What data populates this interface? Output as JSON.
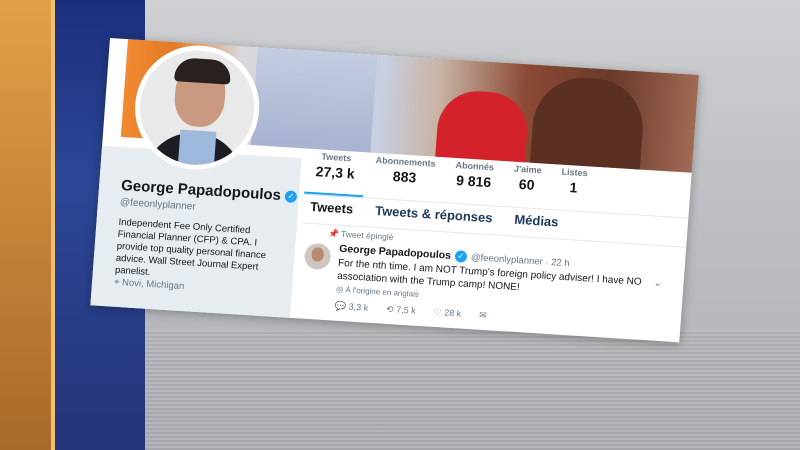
{
  "profile": {
    "name": "George Papadopoulos",
    "handle": "@feeonlyplanner",
    "bio": "Independent Fee Only Certified Financial Planner (CFP) & CPA. I provide top quality personal finance advice. Wall Street Journal Expert panelist.",
    "location": "Novi, Michigan"
  },
  "stats": [
    {
      "label": "Tweets",
      "value": "27,3 k"
    },
    {
      "label": "Abonnements",
      "value": "883"
    },
    {
      "label": "Abonnés",
      "value": "9 816"
    },
    {
      "label": "J'aime",
      "value": "60"
    },
    {
      "label": "Listes",
      "value": "1"
    }
  ],
  "tabs": [
    "Tweets",
    "Tweets & réponses",
    "Médias"
  ],
  "tweet": {
    "pinned_label": "Tweet épinglé",
    "author": "George Papadopoulos",
    "handle_time": "@feeonlyplanner · 22 h",
    "text": "For the nth time. I am NOT Trump's foreign policy adviser! I have NO association with the Trump camp! NONE!",
    "origin": "À l'origine en anglais",
    "replies": "3,3 k",
    "retweets": "7,5 k",
    "likes": "28 k"
  },
  "icons": {
    "verified": "verified-badge-icon",
    "location": "location-pin-icon",
    "pin": "pin-icon",
    "reply": "reply-icon",
    "retweet": "retweet-icon",
    "like": "heart-icon",
    "message": "envelope-icon",
    "chevron": "chevron-down-icon"
  },
  "colors": {
    "accent": "#1da1f2",
    "text": "#14171a",
    "muted": "#657786"
  }
}
